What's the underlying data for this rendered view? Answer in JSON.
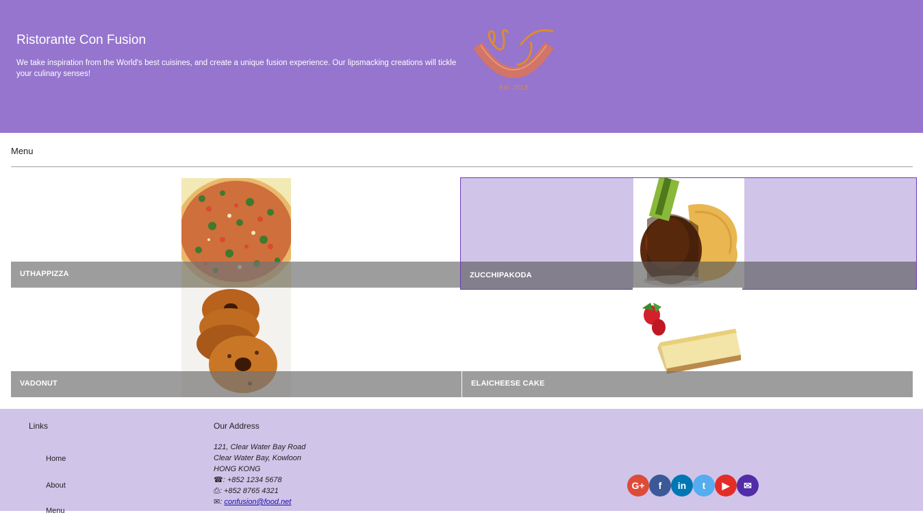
{
  "header": {
    "title": "Ristorante Con Fusion",
    "description": "We take inspiration from the World's best cuisines, and create a unique fusion experience. Our lipsmacking creations will tickle your culinary senses!",
    "logo_text": "Ristorante con Fusion",
    "logo_est": "Est. 2013"
  },
  "menu": {
    "heading": "Menu",
    "items": [
      {
        "name": "UTHAPPIZZA"
      },
      {
        "name": "ZUCCHIPAKODA"
      },
      {
        "name": "VADONUT"
      },
      {
        "name": "ELAICHEESE CAKE"
      }
    ]
  },
  "footer": {
    "links_title": "Links",
    "links": [
      "Home",
      "About",
      "Menu"
    ],
    "address_title": "Our Address",
    "address_lines": [
      "121, Clear Water Bay Road",
      "Clear Water Bay, Kowloon",
      "HONG KONG"
    ],
    "phone": ": +852 1234 5678",
    "fax": ": +852 8765 4321",
    "email": "confusion@food.net"
  },
  "colors": {
    "primary": "#9575cd",
    "light": "#d1c4e9",
    "dark": "#673ab7"
  },
  "social": [
    {
      "icon": "google-plus-icon",
      "label": "G+",
      "color": "#dd4b39"
    },
    {
      "icon": "facebook-icon",
      "label": "f",
      "color": "#3b5998"
    },
    {
      "icon": "linkedin-icon",
      "label": "in",
      "color": "#0077b5"
    },
    {
      "icon": "twitter-icon",
      "label": "t",
      "color": "#55acee"
    },
    {
      "icon": "youtube-icon",
      "label": "▶",
      "color": "#e52d27"
    },
    {
      "icon": "mail-icon",
      "label": "✉",
      "color": "#512da8"
    }
  ]
}
